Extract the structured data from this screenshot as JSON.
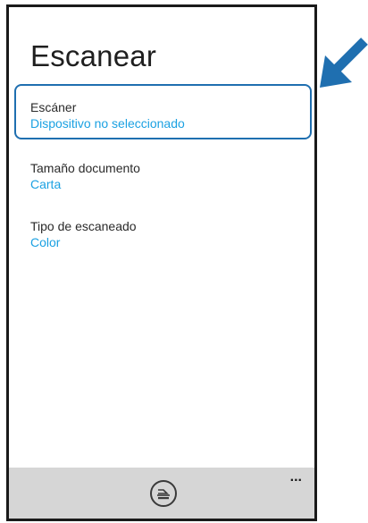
{
  "screen": {
    "title": "Escanear"
  },
  "settings": [
    {
      "label": "Escáner",
      "value": "Dispositivo no seleccionado"
    },
    {
      "label": "Tamaño documento",
      "value": "Carta"
    },
    {
      "label": "Tipo de escaneado",
      "value": "Color"
    }
  ],
  "app_bar": {
    "primary_icon": "scan-icon",
    "more_label": "..."
  },
  "annotation": {
    "arrow_icon": "callout-arrow-icon",
    "highlight_target": "Escáner"
  },
  "colors": {
    "accent": "#1ba1e2",
    "highlight": "#1f6fb0",
    "app_bar": "#d6d6d6",
    "frame": "#1a1a1a"
  }
}
